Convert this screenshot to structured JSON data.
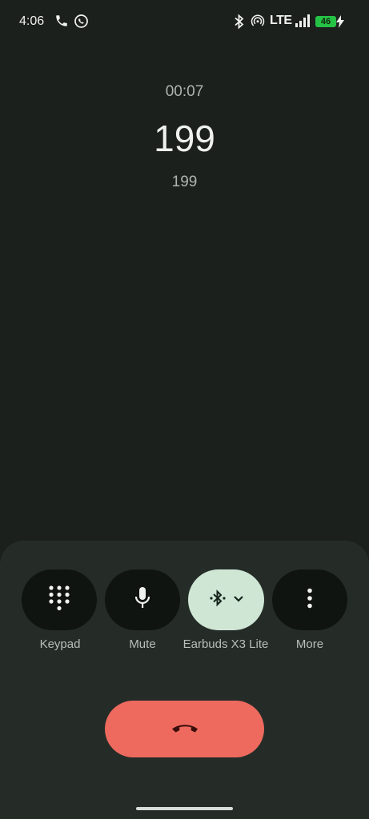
{
  "status_bar": {
    "time": "4:06",
    "network": "LTE",
    "battery": "46",
    "icons": [
      "phone-call-icon",
      "whatsapp-icon",
      "bluetooth-icon",
      "hotspot-icon",
      "signal-icon",
      "battery-charging-icon"
    ]
  },
  "call": {
    "duration": "00:07",
    "name": "199",
    "number": "199"
  },
  "controls": {
    "keypad": "Keypad",
    "mute": "Mute",
    "audio_route": "Earbuds X3 Lite",
    "more": "More"
  },
  "colors": {
    "background": "#1b201d",
    "sheet": "#252c28",
    "active_button": "#cfe6d5",
    "end_call": "#ee6a5e",
    "battery": "#25c245"
  }
}
